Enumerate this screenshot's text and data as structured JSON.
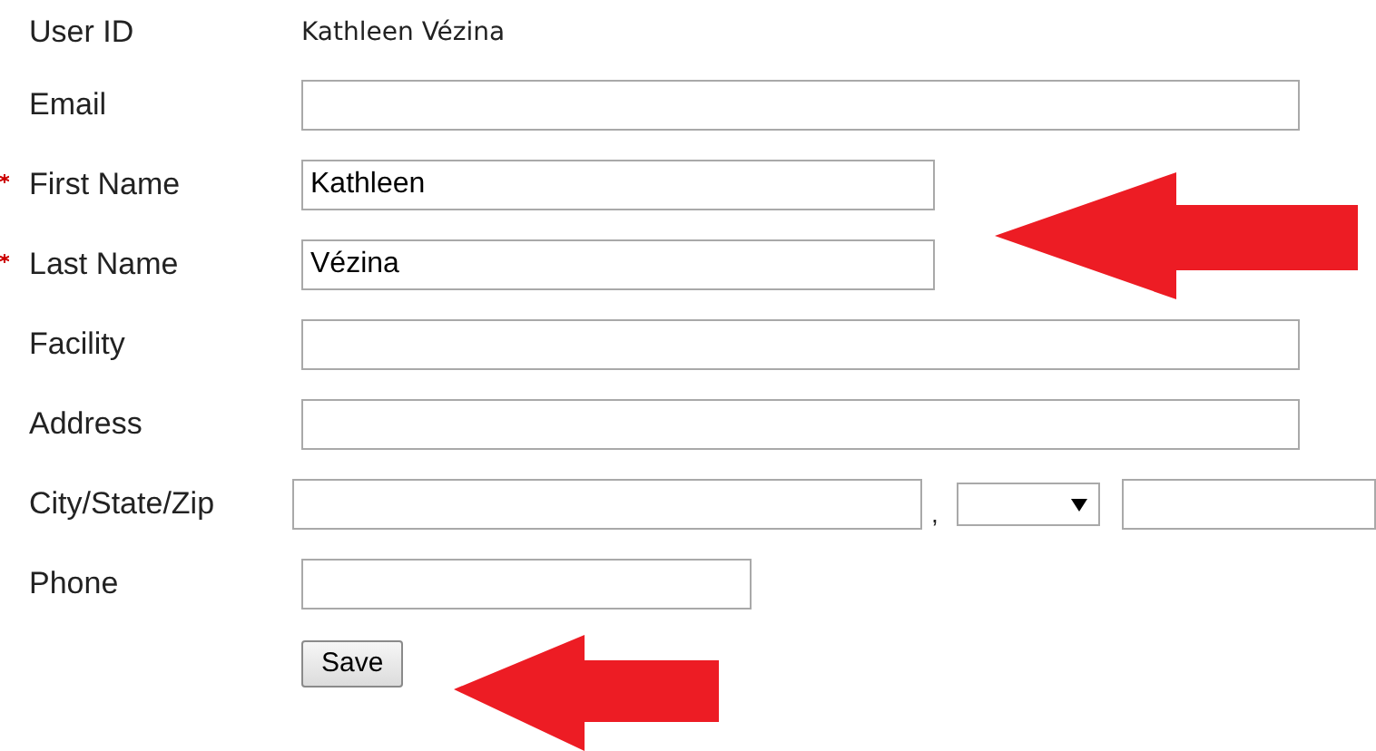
{
  "fields": [
    {
      "label": "User ID",
      "kind": "static",
      "value": "Kathleen Vézina",
      "required": false
    },
    {
      "label": "Email",
      "kind": "wide-text",
      "required": false
    },
    {
      "label": "First Name",
      "kind": "half-text",
      "value": "Kathleen",
      "required": true
    },
    {
      "label": "Last Name",
      "kind": "half-text",
      "value": "Vézina",
      "required": true
    },
    {
      "label": "Facility",
      "kind": "wide-text",
      "required": false
    },
    {
      "label": "Address",
      "kind": "wide-text",
      "required": false
    },
    {
      "label": "City/State/Zip",
      "kind": "city-state-zip",
      "separator": ",",
      "required": false
    },
    {
      "label": "Phone",
      "kind": "short-text",
      "required": false
    }
  ],
  "save_button": "Save"
}
